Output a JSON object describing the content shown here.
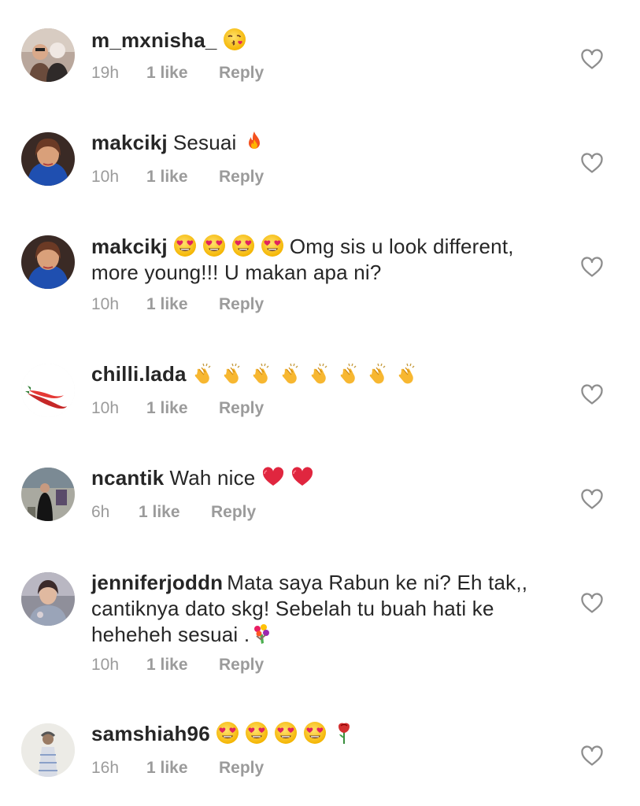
{
  "comments": [
    {
      "username": "m_mxnisha_",
      "text": "😘",
      "time": "19h",
      "likes": "1 like",
      "reply": "Reply",
      "avatar": "avatar-photo"
    },
    {
      "username": "makcikj",
      "text": "Sesuai 🔥",
      "time": "10h",
      "likes": "1 like",
      "reply": "Reply",
      "avatar": "avatar-photo"
    },
    {
      "username": "makcikj",
      "text": "😍😍😍😍 Omg sis u look different, more young!!! U makan apa ni?",
      "time": "10h",
      "likes": "1 like",
      "reply": "Reply",
      "avatar": "avatar-photo"
    },
    {
      "username": "chilli.lada",
      "text": "👏👏👏👏👏👏👏👏",
      "time": "10h",
      "likes": "1 like",
      "reply": "Reply",
      "avatar": "chilli-pepper-logo"
    },
    {
      "username": "ncantik",
      "text": "Wah nice ❤️❤️",
      "time": "6h",
      "likes": "1 like",
      "reply": "Reply",
      "avatar": "avatar-photo"
    },
    {
      "username": "jenniferjoddn",
      "text": "Mata saya Rabun ke ni? Eh tak,, cantiknya dato skg! Sebelah tu buah hati ke heheheh sesuai .💐",
      "time": "10h",
      "likes": "1 like",
      "reply": "Reply",
      "avatar": "avatar-photo"
    },
    {
      "username": "samshiah96",
      "text": "😍😍😍😍🌹",
      "time": "16h",
      "likes": "1 like",
      "reply": "Reply",
      "avatar": "avatar-photo"
    }
  ],
  "icons": {
    "like": "heart-outline-icon"
  },
  "colors": {
    "text": "#262626",
    "meta": "#9b9b9b",
    "background": "#ffffff"
  }
}
